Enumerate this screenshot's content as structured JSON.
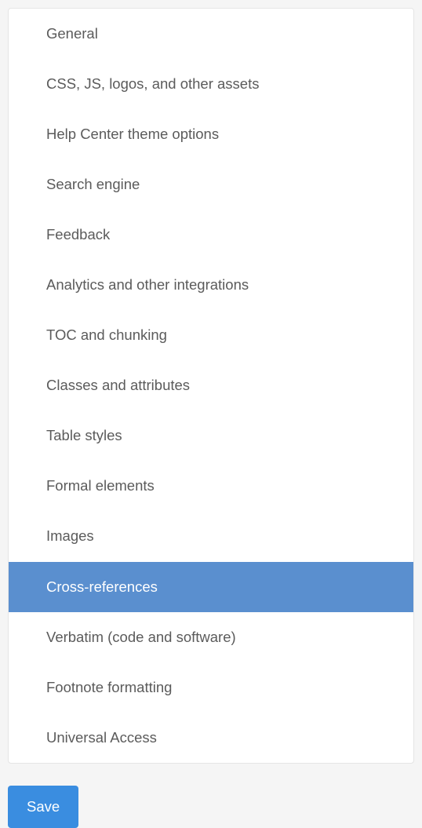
{
  "nav": {
    "items": [
      {
        "label": "General",
        "selected": false
      },
      {
        "label": "CSS, JS, logos, and other assets",
        "selected": false
      },
      {
        "label": "Help Center theme options",
        "selected": false
      },
      {
        "label": "Search engine",
        "selected": false
      },
      {
        "label": "Feedback",
        "selected": false
      },
      {
        "label": "Analytics and other integrations",
        "selected": false
      },
      {
        "label": "TOC and chunking",
        "selected": false
      },
      {
        "label": "Classes and attributes",
        "selected": false
      },
      {
        "label": "Table styles",
        "selected": false
      },
      {
        "label": "Formal elements",
        "selected": false
      },
      {
        "label": "Images",
        "selected": false
      },
      {
        "label": "Cross-references",
        "selected": true
      },
      {
        "label": "Verbatim (code and software)",
        "selected": false
      },
      {
        "label": "Footnote formatting",
        "selected": false
      },
      {
        "label": "Universal Access",
        "selected": false
      }
    ]
  },
  "actions": {
    "save_label": "Save"
  }
}
